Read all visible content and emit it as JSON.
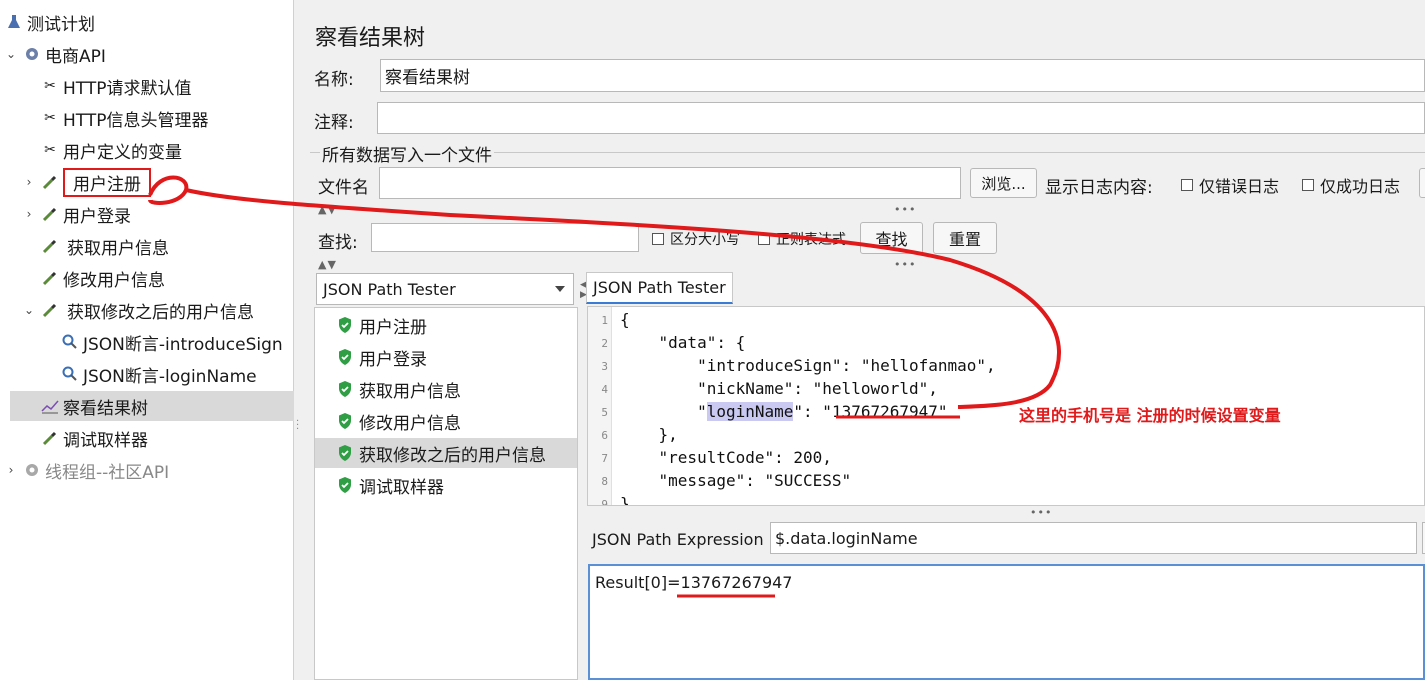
{
  "tree": {
    "items": [
      {
        "label": "测试计划",
        "icon": "test-plan-icon"
      },
      {
        "label": "电商API",
        "icon": "gear-icon"
      },
      {
        "label": "HTTP请求默认值",
        "icon": "tools-icon"
      },
      {
        "label": "HTTP信息头管理器",
        "icon": "tools-icon"
      },
      {
        "label": "用户定义的变量",
        "icon": "tools-icon"
      },
      {
        "label": "用户注册",
        "icon": "pipette-icon"
      },
      {
        "label": "用户登录",
        "icon": "pipette-icon"
      },
      {
        "label": "获取用户信息",
        "icon": "pipette-icon"
      },
      {
        "label": "修改用户信息",
        "icon": "pipette-icon"
      },
      {
        "label": "获取修改之后的用户信息",
        "icon": "pipette-icon"
      },
      {
        "label": "JSON断言-introduceSign",
        "icon": "magnifier-icon"
      },
      {
        "label": "JSON断言-loginName",
        "icon": "magnifier-icon"
      },
      {
        "label": "察看结果树",
        "icon": "chart-icon"
      },
      {
        "label": "调试取样器",
        "icon": "pipette-icon"
      },
      {
        "label": "线程组--社区API",
        "icon": "gear-icon"
      }
    ]
  },
  "panel": {
    "title": "察看结果树",
    "name_label": "名称:",
    "name_value": "察看结果树",
    "comment_label": "注释:",
    "comment_value": "",
    "write_all_label": "所有数据写入一个文件",
    "filename_label": "文件名",
    "filename_value": "",
    "browse_label": "浏览...",
    "log_content_label": "显示日志内容:",
    "errors_only_label": "仅错误日志",
    "success_only_label": "仅成功日志",
    "search_label": "查找:",
    "search_value": "",
    "case_sensitive_label": "区分大小写",
    "regex_label": "正则表达式",
    "find_button": "查找",
    "reset_button": "重置"
  },
  "results": {
    "renderer": "JSON Path Tester",
    "samples": [
      {
        "label": "用户注册"
      },
      {
        "label": "用户登录"
      },
      {
        "label": "获取用户信息"
      },
      {
        "label": "修改用户信息"
      },
      {
        "label": "获取修改之后的用户信息"
      },
      {
        "label": "调试取样器"
      }
    ],
    "tab_label": "JSON Path Tester",
    "code_lines": [
      {
        "n": "1",
        "text": "{"
      },
      {
        "n": "2",
        "text": "    \"data\": {"
      },
      {
        "n": "3",
        "text": "        \"introduceSign\": \"hellofanmao\","
      },
      {
        "n": "4",
        "text": "        \"nickName\": \"helloworld\","
      },
      {
        "n": "5",
        "pre": "        \"",
        "hl": "loginName",
        "post": "\": \"13767267947\""
      },
      {
        "n": "6",
        "text": "    },"
      },
      {
        "n": "7",
        "text": "    \"resultCode\": 200,"
      },
      {
        "n": "8",
        "text": "    \"message\": \"SUCCESS\""
      },
      {
        "n": "9",
        "text": "}"
      }
    ],
    "expression_label": "JSON Path Expression",
    "expression_value": "$.data.loginName",
    "result_text": "Result[0]=13767267947"
  },
  "annotation": {
    "text": "这里的手机号是 注册的时候设置变量",
    "color": "#e0191b"
  }
}
